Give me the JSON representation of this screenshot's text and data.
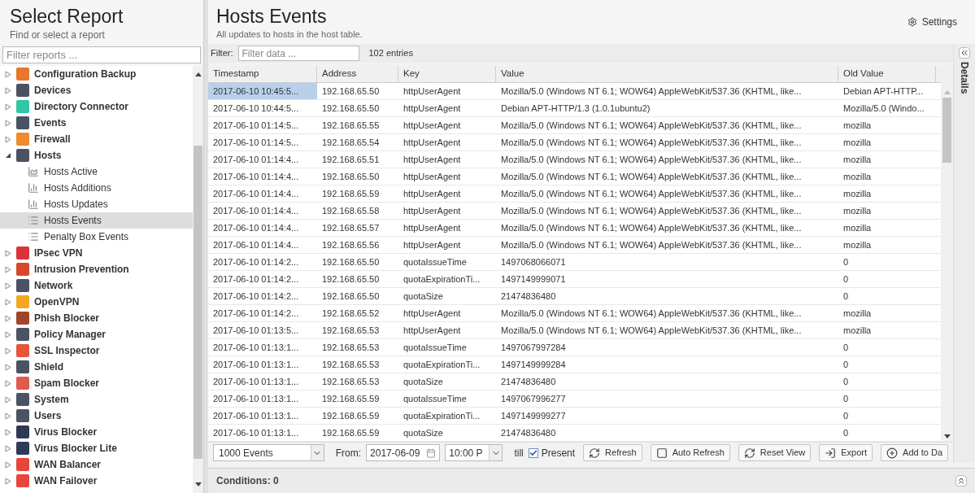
{
  "sidebar": {
    "title": "Select Report",
    "subtitle": "Find or select a report",
    "filter": {
      "placeholder": "Filter reports ..."
    },
    "items": [
      {
        "label": "Configuration Backup",
        "color": "#e8762b",
        "expanded": false,
        "selected": false
      },
      {
        "label": "Devices",
        "color": "#4a5363",
        "expanded": false,
        "selected": false
      },
      {
        "label": "Directory Connector",
        "color": "#2fc7a6",
        "expanded": false,
        "selected": false
      },
      {
        "label": "Events",
        "color": "#4a5363",
        "expanded": false,
        "selected": false
      },
      {
        "label": "Firewall",
        "color": "#f08a2c",
        "expanded": false,
        "selected": false
      },
      {
        "label": "Hosts",
        "color": "#4a5363",
        "expanded": true,
        "selected": false,
        "children": [
          {
            "label": "Hosts Active",
            "kind": "area",
            "selected": false
          },
          {
            "label": "Hosts Additions",
            "kind": "bar",
            "selected": false
          },
          {
            "label": "Hosts Updates",
            "kind": "bar",
            "selected": false
          },
          {
            "label": "Hosts Events",
            "kind": "list",
            "selected": true
          },
          {
            "label": "Penalty Box Events",
            "kind": "list",
            "selected": false
          }
        ]
      },
      {
        "label": "IPsec VPN",
        "color": "#d9343a",
        "expanded": false,
        "selected": false
      },
      {
        "label": "Intrusion Prevention",
        "color": "#d9472b",
        "expanded": false,
        "selected": false
      },
      {
        "label": "Network",
        "color": "#4a5363",
        "expanded": false,
        "selected": false
      },
      {
        "label": "OpenVPN",
        "color": "#f5a623",
        "expanded": false,
        "selected": false
      },
      {
        "label": "Phish Blocker",
        "color": "#a0452a",
        "expanded": false,
        "selected": false
      },
      {
        "label": "Policy Manager",
        "color": "#4a5363",
        "expanded": false,
        "selected": false
      },
      {
        "label": "SSL Inspector",
        "color": "#e8553a",
        "expanded": false,
        "selected": false
      },
      {
        "label": "Shield",
        "color": "#4a5363",
        "expanded": false,
        "selected": false
      },
      {
        "label": "Spam Blocker",
        "color": "#e05a4f",
        "expanded": false,
        "selected": false
      },
      {
        "label": "System",
        "color": "#4a5363",
        "expanded": false,
        "selected": false
      },
      {
        "label": "Users",
        "color": "#4a5363",
        "expanded": false,
        "selected": false
      },
      {
        "label": "Virus Blocker",
        "color": "#2e3a55",
        "expanded": false,
        "selected": false
      },
      {
        "label": "Virus Blocker Lite",
        "color": "#2e3a56",
        "expanded": false,
        "selected": false
      },
      {
        "label": "WAN Balancer",
        "color": "#e8453a",
        "expanded": false,
        "selected": false
      },
      {
        "label": "WAN Failover",
        "color": "#e8453b",
        "expanded": false,
        "selected": false
      }
    ]
  },
  "report": {
    "title": "Hosts Events",
    "subtitle": "All updates to hosts in the host table.",
    "settings": "Settings"
  },
  "filter_bar": {
    "label": "Filter:",
    "placeholder": "Filter data ...",
    "count": "102 entries"
  },
  "table": {
    "columns": [
      "Timestamp",
      "Address",
      "Key",
      "Value",
      "Old Value"
    ],
    "rows": [
      {
        "selected": true,
        "cells": [
          "2017-06-10 10:45:5...",
          "192.168.65.50",
          "httpUserAgent",
          "Mozilla/5.0 (Windows NT 6.1; WOW64) AppleWebKit/537.36 (KHTML, like...",
          "Debian APT-HTTP..."
        ]
      },
      {
        "selected": false,
        "cells": [
          "2017-06-10 10:44:5...",
          "192.168.65.50",
          "httpUserAgent",
          "Debian APT-HTTP/1.3 (1.0.1ubuntu2)",
          "Mozilla/5.0 (Windo..."
        ]
      },
      {
        "selected": false,
        "cells": [
          "2017-06-10 01:14:5...",
          "192.168.65.55",
          "httpUserAgent",
          "Mozilla/5.0 (Windows NT 6.1; WOW64) AppleWebKit/537.36 (KHTML, like...",
          "mozilla"
        ]
      },
      {
        "selected": false,
        "cells": [
          "2017-06-10 01:14:5...",
          "192.168.65.54",
          "httpUserAgent",
          "Mozilla/5.0 (Windows NT 6.1; WOW64) AppleWebKit/537.36 (KHTML, like...",
          "mozilla"
        ]
      },
      {
        "selected": false,
        "cells": [
          "2017-06-10 01:14:4...",
          "192.168.65.51",
          "httpUserAgent",
          "Mozilla/5.0 (Windows NT 6.1; WOW64) AppleWebKit/537.36 (KHTML, like...",
          "mozilla"
        ]
      },
      {
        "selected": false,
        "cells": [
          "2017-06-10 01:14:4...",
          "192.168.65.50",
          "httpUserAgent",
          "Mozilla/5.0 (Windows NT 6.1; WOW64) AppleWebKit/537.36 (KHTML, like...",
          "mozilla"
        ]
      },
      {
        "selected": false,
        "cells": [
          "2017-06-10 01:14:4...",
          "192.168.65.59",
          "httpUserAgent",
          "Mozilla/5.0 (Windows NT 6.1; WOW64) AppleWebKit/537.36 (KHTML, like...",
          "mozilla"
        ]
      },
      {
        "selected": false,
        "cells": [
          "2017-06-10 01:14:4...",
          "192.168.65.58",
          "httpUserAgent",
          "Mozilla/5.0 (Windows NT 6.1; WOW64) AppleWebKit/537.36 (KHTML, like...",
          "mozilla"
        ]
      },
      {
        "selected": false,
        "cells": [
          "2017-06-10 01:14:4...",
          "192.168.65.57",
          "httpUserAgent",
          "Mozilla/5.0 (Windows NT 6.1; WOW64) AppleWebKit/537.36 (KHTML, like...",
          "mozilla"
        ]
      },
      {
        "selected": false,
        "cells": [
          "2017-06-10 01:14:4...",
          "192.168.65.56",
          "httpUserAgent",
          "Mozilla/5.0 (Windows NT 6.1; WOW64) AppleWebKit/537.36 (KHTML, like...",
          "mozilla"
        ]
      },
      {
        "selected": false,
        "cells": [
          "2017-06-10 01:14:2...",
          "192.168.65.50",
          "quotaIssueTime",
          "1497068066071",
          "0"
        ]
      },
      {
        "selected": false,
        "cells": [
          "2017-06-10 01:14:2...",
          "192.168.65.50",
          "quotaExpirationTi...",
          "1497149999071",
          "0"
        ]
      },
      {
        "selected": false,
        "cells": [
          "2017-06-10 01:14:2...",
          "192.168.65.50",
          "quotaSize",
          "21474836480",
          "0"
        ]
      },
      {
        "selected": false,
        "cells": [
          "2017-06-10 01:14:2...",
          "192.168.65.52",
          "httpUserAgent",
          "Mozilla/5.0 (Windows NT 6.1; WOW64) AppleWebKit/537.36 (KHTML, like...",
          "mozilla"
        ]
      },
      {
        "selected": false,
        "cells": [
          "2017-06-10 01:13:5...",
          "192.168.65.53",
          "httpUserAgent",
          "Mozilla/5.0 (Windows NT 6.1; WOW64) AppleWebKit/537.36 (KHTML, like...",
          "mozilla"
        ]
      },
      {
        "selected": false,
        "cells": [
          "2017-06-10 01:13:1...",
          "192.168.65.53",
          "quotaIssueTime",
          "1497067997284",
          "0"
        ]
      },
      {
        "selected": false,
        "cells": [
          "2017-06-10 01:13:1...",
          "192.168.65.53",
          "quotaExpirationTi...",
          "1497149999284",
          "0"
        ]
      },
      {
        "selected": false,
        "cells": [
          "2017-06-10 01:13:1...",
          "192.168.65.53",
          "quotaSize",
          "21474836480",
          "0"
        ]
      },
      {
        "selected": false,
        "cells": [
          "2017-06-10 01:13:1...",
          "192.168.65.59",
          "quotaIssueTime",
          "1497067996277",
          "0"
        ]
      },
      {
        "selected": false,
        "cells": [
          "2017-06-10 01:13:1...",
          "192.168.65.59",
          "quotaExpirationTi...",
          "1497149999277",
          "0"
        ]
      },
      {
        "selected": false,
        "cells": [
          "2017-06-10 01:13:1...",
          "192.168.65.59",
          "quotaSize",
          "21474836480",
          "0"
        ]
      }
    ]
  },
  "details_tab": "Details",
  "toolbar": {
    "limit": "1000 Events",
    "from_label": "From:",
    "date": "2017-06-09",
    "time": "10:00 P",
    "till": "till",
    "present": {
      "label": "Present",
      "checked": true
    },
    "buttons": [
      {
        "label": "Refresh",
        "kind": "refresh"
      },
      {
        "label": "Auto Refresh",
        "kind": "checkbox"
      },
      {
        "label": "Reset View",
        "kind": "refresh"
      },
      {
        "label": "Export",
        "kind": "export"
      },
      {
        "label": "Add to Da",
        "kind": "add"
      }
    ]
  },
  "conditions": "Conditions: 0"
}
